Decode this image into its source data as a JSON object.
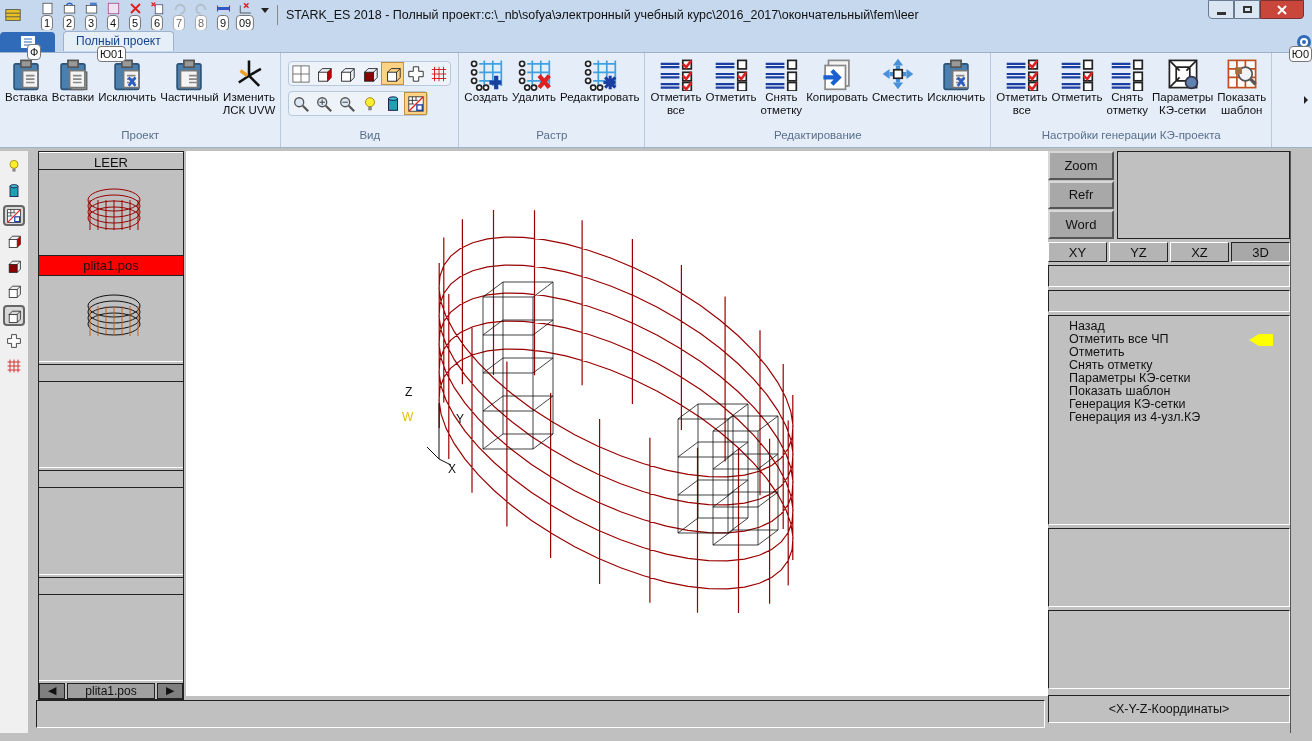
{
  "window": {
    "title": "STARK_ES 2018 - Полный проект:c:\\_nb\\sofya\\электронный учебный курс\\2016_2017\\окончательный\\fem\\leer"
  },
  "quick_access": [
    {
      "key": "1",
      "disabled": false
    },
    {
      "key": "2",
      "disabled": false
    },
    {
      "key": "3",
      "disabled": false
    },
    {
      "key": "4",
      "disabled": false
    },
    {
      "key": "5",
      "disabled": false
    },
    {
      "key": "6",
      "disabled": false
    },
    {
      "key": "7",
      "disabled": true
    },
    {
      "key": "8",
      "disabled": true
    },
    {
      "key": "9",
      "disabled": false
    },
    {
      "key": "09",
      "disabled": false
    }
  ],
  "app_button": {
    "key": "Ф"
  },
  "tabs": [
    {
      "label": "Полный проект",
      "selected": true,
      "key": "Ю01"
    }
  ],
  "help": {
    "key": "Ю0"
  },
  "ribbon_groups": [
    {
      "title": "Проект",
      "kind": "large",
      "buttons": [
        {
          "lines": [
            "Вставка"
          ]
        },
        {
          "lines": [
            "Вставки"
          ]
        },
        {
          "lines": [
            "Исключить"
          ]
        },
        {
          "lines": [
            "Частичный"
          ]
        },
        {
          "lines": [
            "Изменить",
            "ЛСК UVW"
          ]
        }
      ]
    },
    {
      "title": "Вид",
      "kind": "small",
      "rows": [
        [
          {
            "selected": false
          },
          {
            "selected": false
          },
          {
            "selected": false
          },
          {
            "selected": false
          },
          {
            "selected": true
          },
          {
            "selected": false
          },
          {
            "selected": false
          }
        ],
        [
          {
            "selected": false
          },
          {
            "selected": false
          },
          {
            "selected": false
          },
          {
            "selected": false
          },
          {
            "selected": false
          },
          {
            "selected": true
          }
        ]
      ]
    },
    {
      "title": "Растр",
      "kind": "large",
      "buttons": [
        {
          "lines": [
            "Создать"
          ]
        },
        {
          "lines": [
            "Удалить"
          ]
        },
        {
          "lines": [
            "Редактировать"
          ]
        }
      ]
    },
    {
      "title": "Редактирование",
      "kind": "large",
      "buttons": [
        {
          "lines": [
            "Отметить",
            "все"
          ]
        },
        {
          "lines": [
            "Отметить"
          ]
        },
        {
          "lines": [
            "Снять",
            "отметку"
          ]
        },
        {
          "lines": [
            "Копировать"
          ]
        },
        {
          "lines": [
            "Сместить"
          ]
        },
        {
          "lines": [
            "Исключить"
          ]
        }
      ]
    },
    {
      "title": "Настройки генерации КЭ-проекта",
      "kind": "large",
      "buttons": [
        {
          "lines": [
            "Отметить",
            "все"
          ]
        },
        {
          "lines": [
            "Отметить"
          ]
        },
        {
          "lines": [
            "Снять",
            "отметку"
          ]
        },
        {
          "lines": [
            "Параметры",
            "КЭ-сетки"
          ]
        },
        {
          "lines": [
            "Показать",
            "шаблон"
          ]
        }
      ]
    }
  ],
  "side_toolbar": [
    {
      "selected": false
    },
    {
      "selected": false
    },
    {
      "selected": true
    },
    {
      "selected": false
    },
    {
      "selected": false
    },
    {
      "selected": false
    },
    {
      "selected": true
    },
    {
      "selected": false
    },
    {
      "selected": false
    }
  ],
  "positions_panel": {
    "header": "LEER",
    "items": [
      {
        "label": "plita1.pos",
        "selected": true
      }
    ],
    "nav": {
      "prev": "◀",
      "current": "plita1.pos",
      "next": "▶"
    }
  },
  "canvas": {
    "axis_labels": [
      "Z",
      "W",
      "Y",
      "X"
    ]
  },
  "right_panel": {
    "buttons": [
      "Zoom",
      "Refr",
      "Word"
    ],
    "view_tabs": [
      {
        "label": "XY",
        "selected": false
      },
      {
        "label": "YZ",
        "selected": false
      },
      {
        "label": "XZ",
        "selected": false
      },
      {
        "label": "3D",
        "selected": true
      }
    ],
    "menu": [
      {
        "label": "Назад",
        "selected": false
      },
      {
        "label": "Отметить все ЧП",
        "selected": true
      },
      {
        "label": "Отметить",
        "selected": false
      },
      {
        "label": "Снять отметку",
        "selected": false
      },
      {
        "label": "Параметры КЭ-сетки",
        "selected": false
      },
      {
        "label": "Показать шаблон",
        "selected": false
      },
      {
        "label": "Генерация КЭ-сетки",
        "selected": false
      },
      {
        "label": "Генерация из 4-узл.КЭ",
        "selected": false
      }
    ],
    "coordinates": "<X-Y-Z-Координаты>"
  }
}
